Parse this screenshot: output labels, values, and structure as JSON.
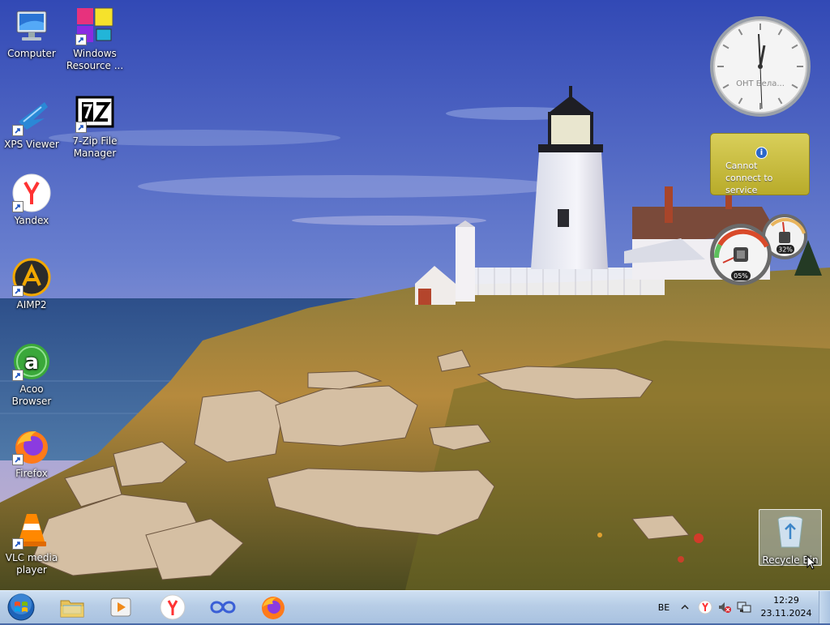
{
  "desktop": {
    "icons": [
      {
        "label": "Computer",
        "icon": "computer-icon"
      },
      {
        "label": "Windows Resource ...",
        "icon": "windows-resource-icon"
      },
      {
        "label": "XPS Viewer",
        "icon": "xps-viewer-icon"
      },
      {
        "label": "7-Zip File Manager",
        "icon": "seven-zip-icon"
      },
      {
        "label": "Yandex",
        "icon": "yandex-icon"
      },
      {
        "label": "AIMP2",
        "icon": "aimp-icon"
      },
      {
        "label": "Acoo Browser",
        "icon": "acoo-browser-icon"
      },
      {
        "label": "Firefox",
        "icon": "firefox-icon"
      },
      {
        "label": "VLC media player",
        "icon": "vlc-icon"
      },
      {
        "label": "Recycle Bin",
        "icon": "recycle-bin-icon"
      }
    ]
  },
  "gadgets": {
    "clock": {
      "city": "ОНТ Бела..."
    },
    "weather": {
      "message": "Cannot connect to service",
      "icon": "info-icon"
    },
    "cpu_meter": {
      "cpu_percent": "05%",
      "memory_percent": "32%"
    }
  },
  "taskbar": {
    "start": "start-orb-icon",
    "pinned": [
      "explorer-icon",
      "media-player-icon",
      "yandex-icon",
      "acoo-browser-icon",
      "firefox-icon"
    ],
    "tray": {
      "language": "BE",
      "icons": [
        "show-hidden-icons-icon",
        "yandex-tray-icon",
        "volume-muted-icon",
        "network-icon"
      ]
    },
    "clock": {
      "time": "12:29",
      "date": "23.11.2024"
    }
  },
  "colors": {
    "taskbar": "#b7cde6",
    "sky": "#3b54b8",
    "weather_gadget": "#c9bd3a"
  }
}
